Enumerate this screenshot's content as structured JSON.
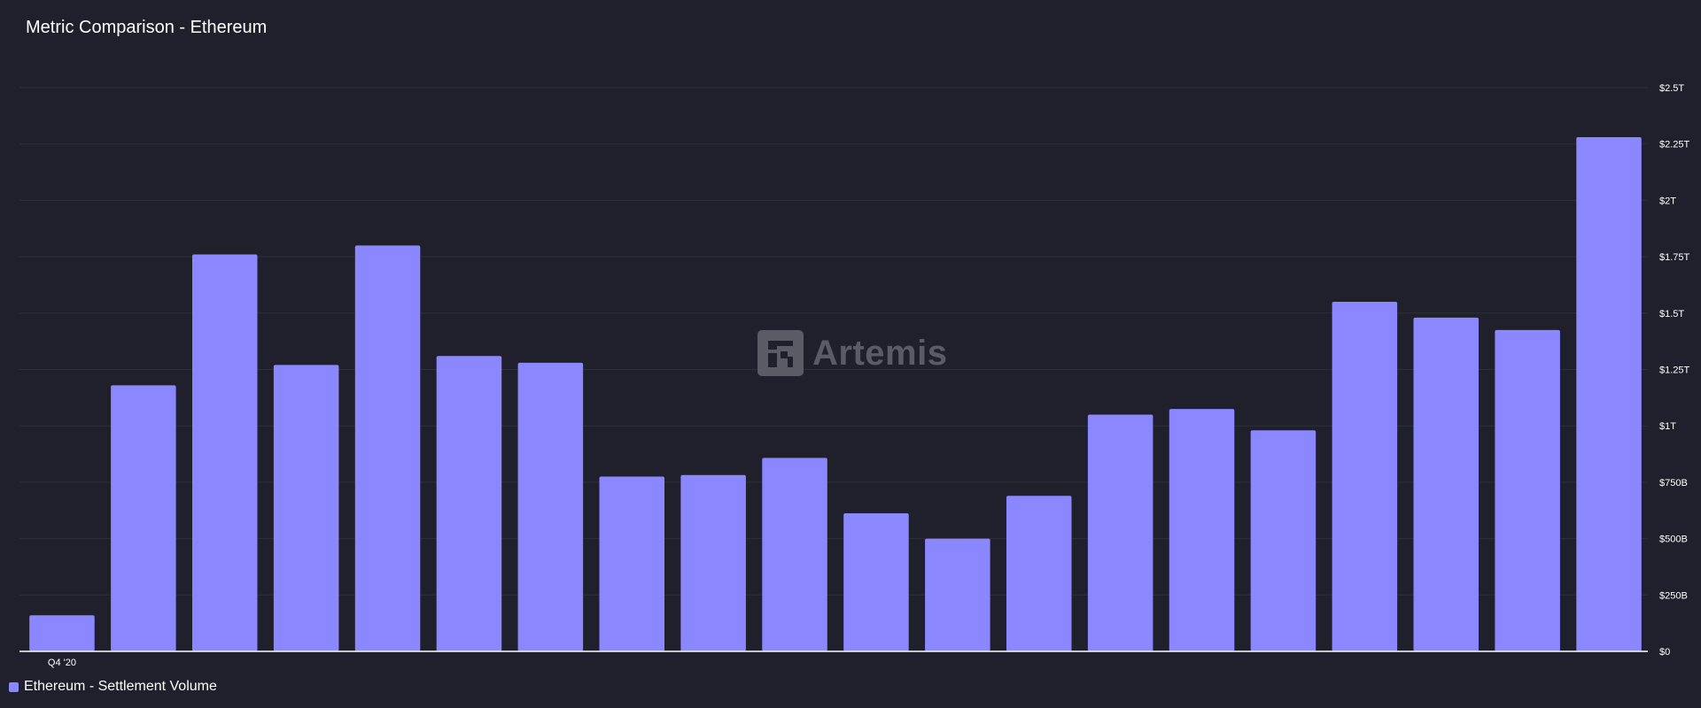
{
  "title": "Metric Comparison - Ethereum",
  "watermark": "Artemis",
  "colors": {
    "background": "#1f202c",
    "bar": "#8b87ff",
    "grid": "#2e2f3b",
    "axis": "#ffffff",
    "text": "#ffffff",
    "watermark": "#5a5b64"
  },
  "chart_data": {
    "type": "bar",
    "title": "Metric Comparison - Ethereum",
    "categories": [
      "Q4 '20",
      "",
      "",
      "",
      "",
      "",
      "",
      "",
      "",
      "",
      "",
      "",
      "",
      "",
      "",
      "",
      "",
      "",
      "",
      ""
    ],
    "x_tick_labels": [
      "Q4 '20"
    ],
    "series": [
      {
        "name": "Ethereum - Settlement Volume",
        "values": [
          160,
          1180,
          1760,
          1270,
          1800,
          1310,
          1280,
          775,
          782,
          858,
          612,
          500,
          690,
          1050,
          1075,
          980,
          1550,
          1480,
          1425,
          2280
        ]
      }
    ],
    "units": "billions USD",
    "ylim": [
      0,
      2500
    ],
    "y_ticks": [
      0,
      250,
      500,
      750,
      1000,
      1250,
      1500,
      1750,
      2000,
      2250,
      2500
    ],
    "y_tick_labels": [
      "$0",
      "$250B",
      "$500B",
      "$750B",
      "$1T",
      "$1.25T",
      "$1.5T",
      "$1.75T",
      "$2T",
      "$2.25T",
      "$2.5T"
    ],
    "y_axis_side": "right",
    "grid": true,
    "legend": "bottom-left"
  }
}
